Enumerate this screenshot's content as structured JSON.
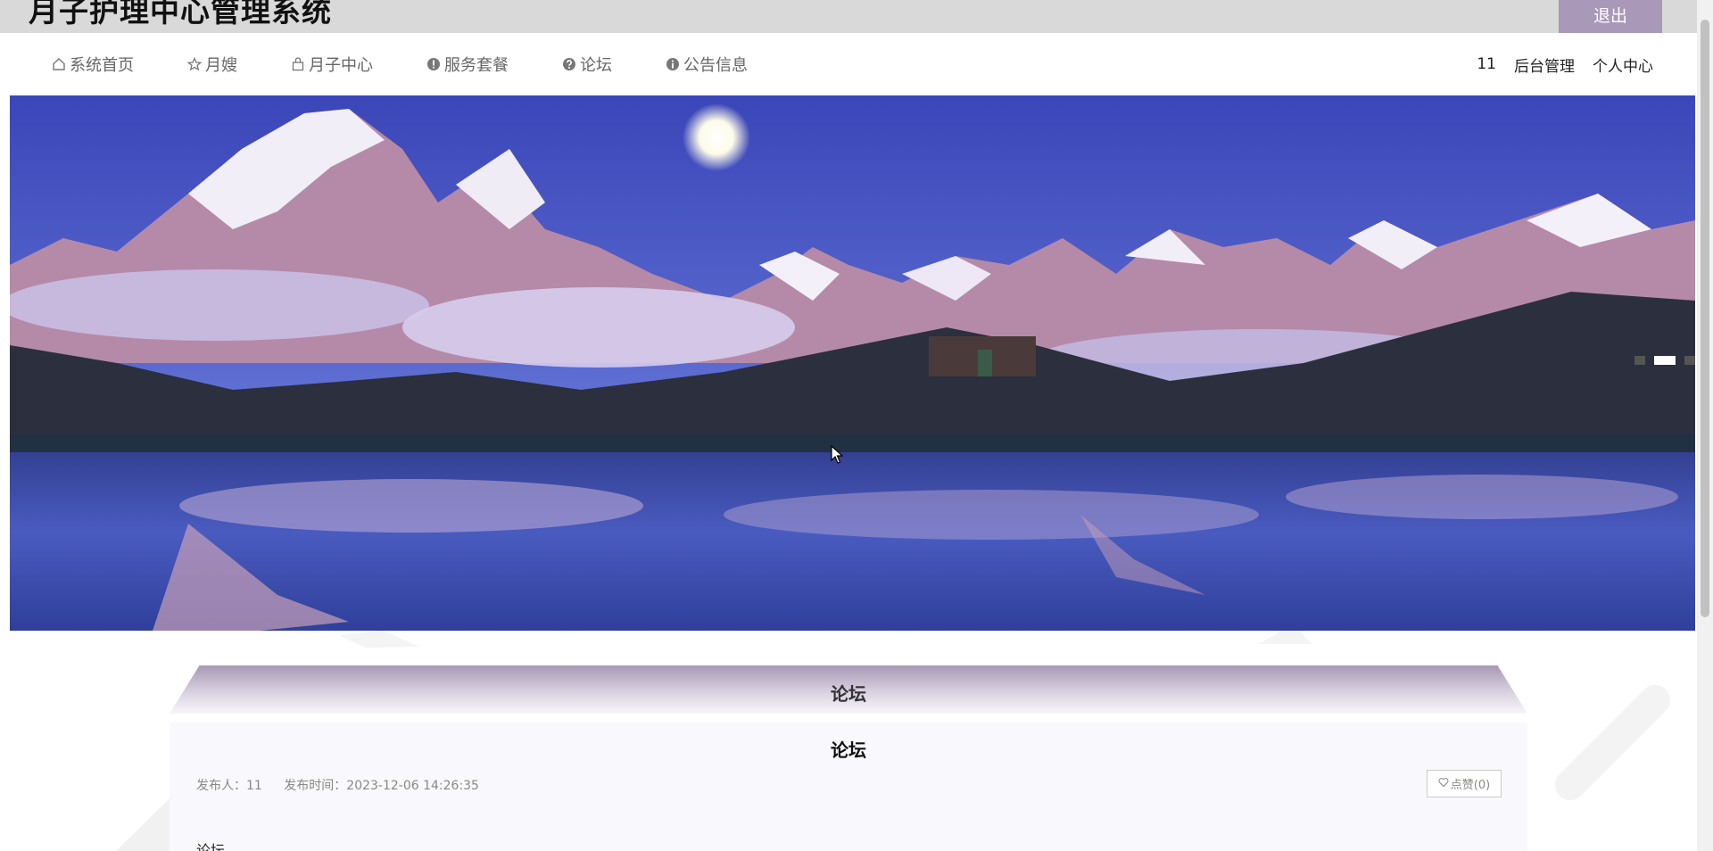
{
  "header": {
    "site_title": "月子护理中心管理系统",
    "logout_label": "退出"
  },
  "nav": {
    "items": [
      {
        "label": "系统首页",
        "icon": "home-icon"
      },
      {
        "label": "月嫂",
        "icon": "star-icon"
      },
      {
        "label": "月子中心",
        "icon": "bag-icon"
      },
      {
        "label": "服务套餐",
        "icon": "exclamation-circle-icon"
      },
      {
        "label": "论坛",
        "icon": "question-circle-icon"
      },
      {
        "label": "公告信息",
        "icon": "info-circle-icon"
      }
    ],
    "username": "11",
    "admin_label": "后台管理",
    "profile_label": "个人中心"
  },
  "banner": {
    "slide_count": 3,
    "active_slide": 2
  },
  "section": {
    "title": "论坛"
  },
  "post": {
    "title": "论坛",
    "author_label": "发布人：11",
    "time_label": "发布时间：2023-12-06 14:26:35",
    "like_label": "点赞(0)",
    "body_start": "论坛"
  },
  "colors": {
    "topbar_bg": "#d9d9d9",
    "accent": "#a998b8",
    "content_bg": "#f9f8fc"
  }
}
